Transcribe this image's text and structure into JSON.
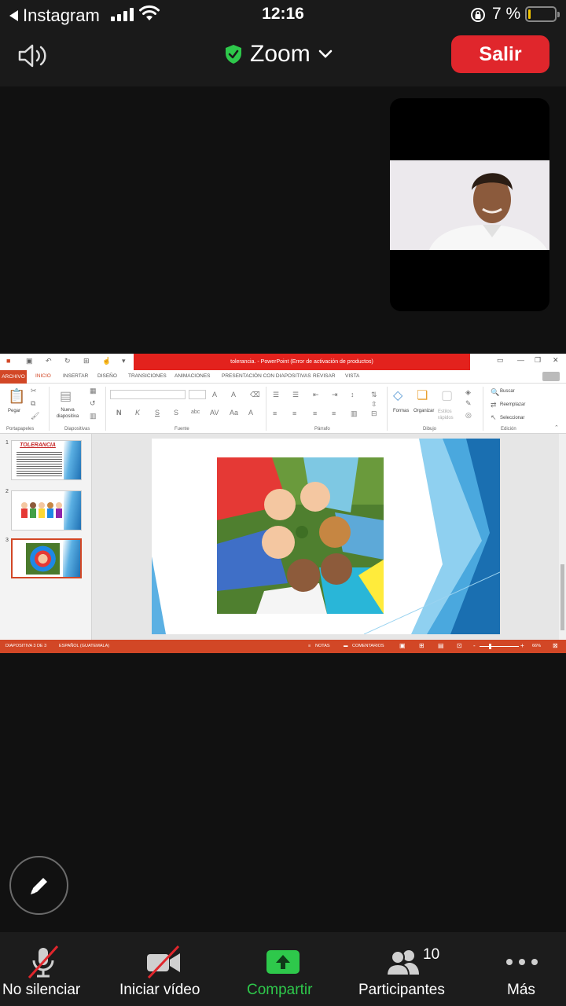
{
  "status_bar": {
    "back_app": "Instagram",
    "time": "12:16",
    "battery": "7 %",
    "battery_level": 0.07
  },
  "topbar": {
    "title": "Zoom",
    "leave_label": "Salir"
  },
  "shared_screen": {
    "app_title": "tolerancia. - PowerPoint (Error de activación de productos)",
    "tabs": [
      "ARCHIVO",
      "INICIO",
      "INSERTAR",
      "DISEÑO",
      "TRANSICIONES",
      "ANIMACIONES",
      "PRESENTACIÓN CON DIAPOSITIVAS",
      "REVISAR",
      "VISTA"
    ],
    "active_tab": "INICIO",
    "groups": [
      "Portapapeles",
      "Diapositivas",
      "Fuente",
      "Párrafo",
      "Dibujo",
      "Edición"
    ],
    "ribbon": {
      "paste": "Pegar",
      "new_slide": "Nueva diapositiva",
      "shapes": "Formas",
      "arrange": "Organizar",
      "quick_styles": "Estilos rápidos",
      "find": "Buscar",
      "replace": "Reemplazar",
      "select": "Seleccionar"
    },
    "thumbnails": [
      {
        "num": "1",
        "title": "TOLERANCIA"
      },
      {
        "num": "2",
        "title": ""
      },
      {
        "num": "3",
        "title": ""
      }
    ],
    "selected_slide": 3,
    "status": {
      "slide_info": "DIAPOSITIVA 3 DE 3",
      "language": "ESPAÑOL (GUATEMALA)",
      "notes": "NOTAS",
      "comments": "COMENTARIOS",
      "zoom": "66%"
    }
  },
  "toolbar": {
    "mute": "No silenciar",
    "video": "Iniciar vídeo",
    "share": "Compartir",
    "participants": "Participantes",
    "participants_count": "10",
    "more": "Más"
  },
  "colors": {
    "leave": "#e0262c",
    "share_green": "#2ec84b",
    "ppt_accent": "#d24726",
    "shield": "#2ec84b"
  }
}
